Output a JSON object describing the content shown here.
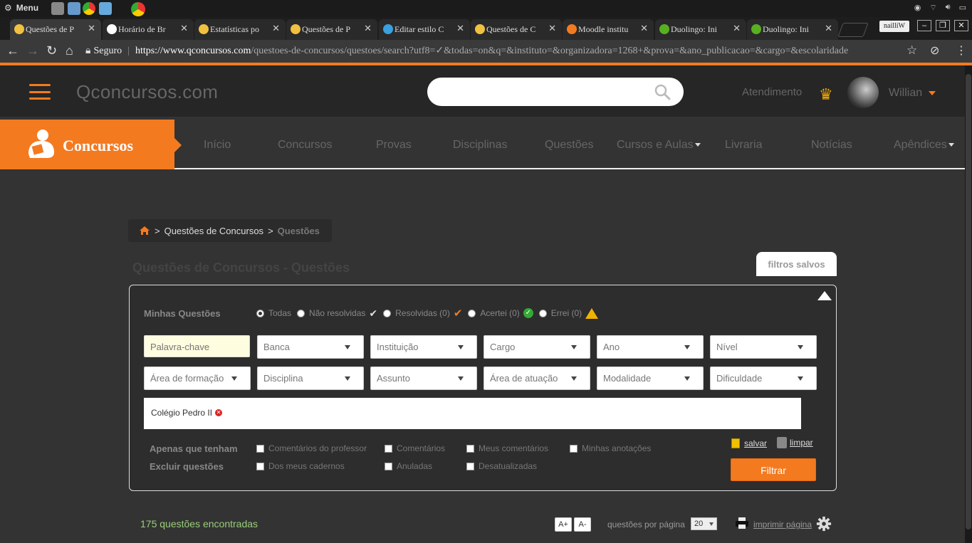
{
  "os_bar": {
    "menu_label": "Menu"
  },
  "tabs": [
    {
      "title": "Questões de P",
      "fav_color": "#f0c040",
      "active": true
    },
    {
      "title": "Horário de Br",
      "fav_color": "#ffffff"
    },
    {
      "title": "Estatísticas po",
      "fav_color": "#f0c040"
    },
    {
      "title": "Questões de P",
      "fav_color": "#f0c040"
    },
    {
      "title": "Editar estilo C",
      "fav_color": "#3aa0e0"
    },
    {
      "title": "Questões de C",
      "fav_color": "#f0c040"
    },
    {
      "title": "Moodle institu",
      "fav_color": "#f47a20"
    },
    {
      "title": "Duolingo: Ini",
      "fav_color": "#58b020"
    },
    {
      "title": "Duolingo: Ini",
      "fav_color": "#58b020"
    }
  ],
  "profile_chip": "nailliW",
  "address": {
    "secure_label": "Seguro",
    "host": "https://www.qconcursos.com",
    "path": "/questoes-de-concursos/questoes/search?utf8=✓&todas=on&q=&instituto=&organizadora=1268+&prova=&ano_publicacao=&cargo=&escolaridade"
  },
  "header": {
    "logo": "Qconcursos.com",
    "search_placeholder": "",
    "atendimento": "Atendimento",
    "username": "Willian"
  },
  "nav": {
    "brand": "Concursos",
    "items": [
      "Início",
      "Concursos",
      "Provas",
      "Disciplinas",
      "Questões",
      "Cursos e Aulas",
      "Livraria",
      "Notícias",
      "Apêndices"
    ]
  },
  "breadcrumb": {
    "sep": ">",
    "parent": "Questões de Concursos",
    "current": "Questões"
  },
  "page_title": "Questões de Concursos - Questões",
  "saved_filters": "filtros salvos",
  "filters": {
    "minhas_label": "Minhas Questões",
    "radios": [
      "Todas",
      "Não resolvidas",
      "Resolvidas (0)",
      "Acertei (0)",
      "Errei (0)"
    ],
    "keyword_placeholder": "Palavra-chave",
    "row1": [
      "Banca",
      "Instituição",
      "Cargo",
      "Ano",
      "Nível"
    ],
    "row2": [
      "Área de formação",
      "Disciplina",
      "Assunto",
      "Área de atuação",
      "Modalidade",
      "Dificuldade"
    ],
    "active_tag": "Colégio Pedro II",
    "apenas_label": "Apenas que tenham",
    "apenas_opts": [
      "Comentários do professor",
      "Comentários",
      "Meus comentários",
      "Minhas anotações"
    ],
    "excluir_label": "Excluir questões",
    "excluir_opts": [
      "Dos meus cadernos",
      "Anuladas",
      "Desatualizadas"
    ],
    "save_label": "salvar",
    "clear_label": "limpar",
    "submit_label": "Filtrar"
  },
  "results": {
    "count_text": "175 questões encontradas",
    "font_up": "A+",
    "font_down": "A-",
    "per_page_label": "questões por página",
    "per_page_value": "20",
    "print_label": "imprimir página"
  }
}
